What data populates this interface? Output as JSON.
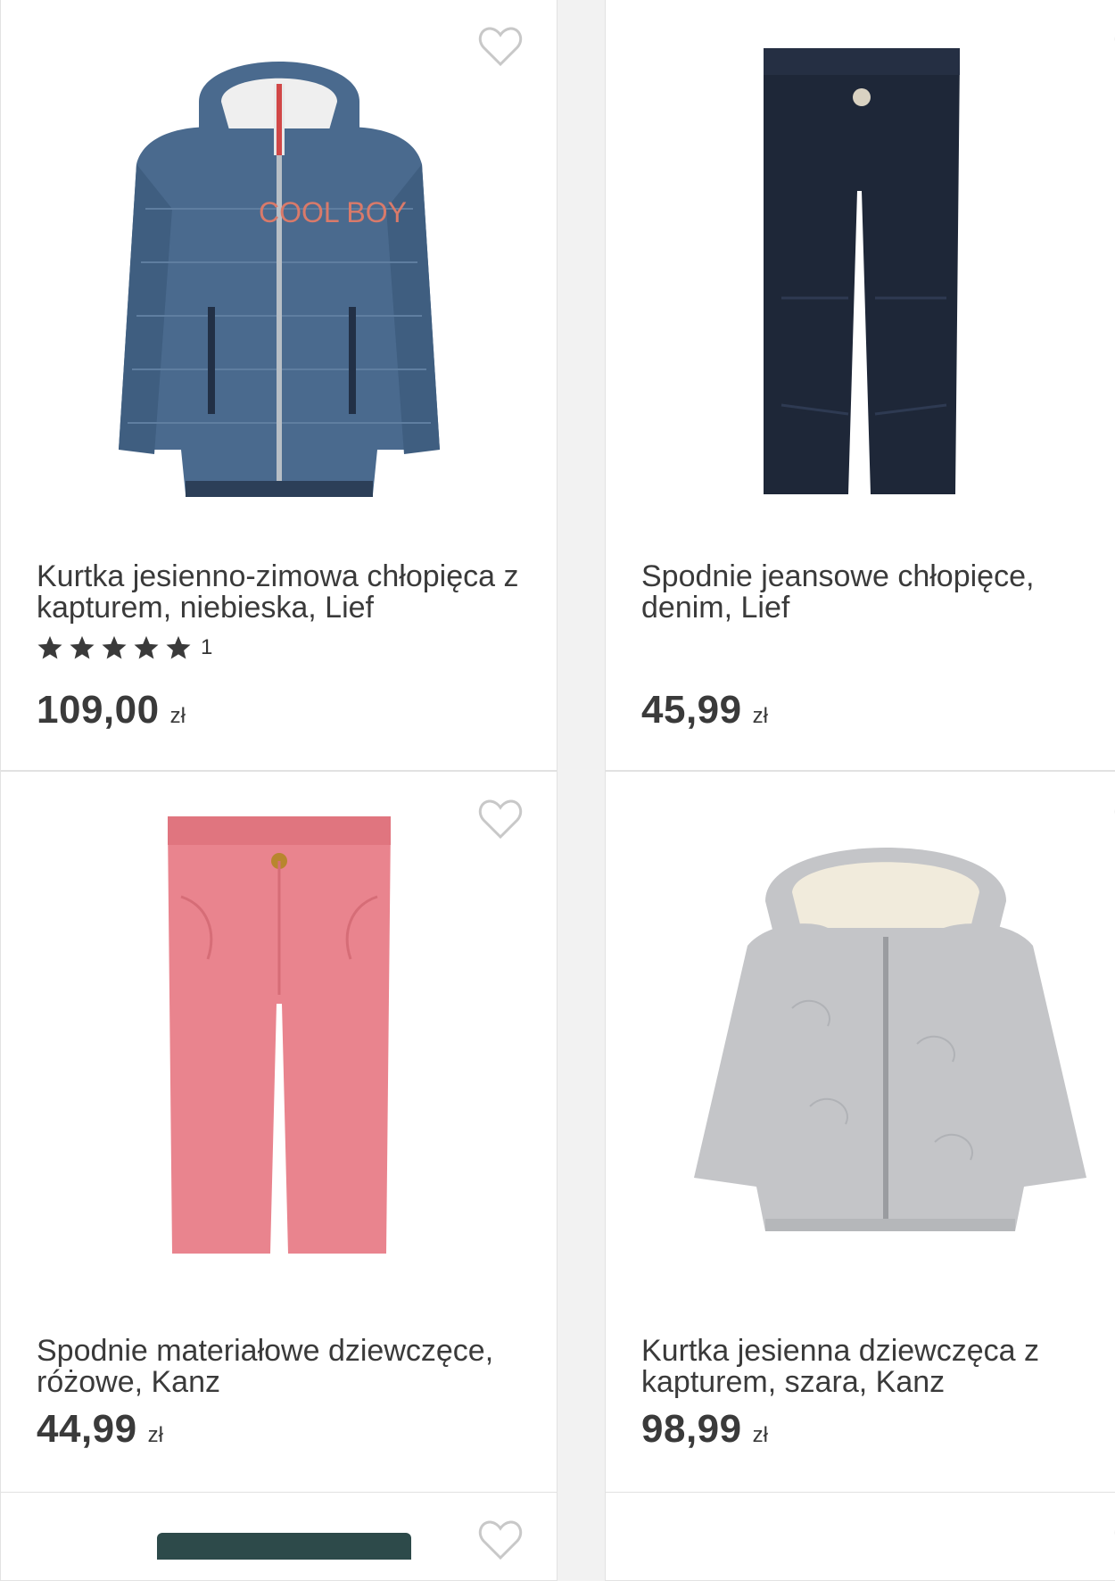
{
  "currency": "zł",
  "products": [
    {
      "title": "Kurtka jesienno-zimowa chłopięca z kapturem, niebieska, Lief",
      "rating_stars": 5,
      "rating_count": "1",
      "price": "109,00",
      "image_icon": "blue-puffer-jacket-image",
      "image_text": "COOL BOY",
      "color": "#4a6a8e"
    },
    {
      "title": "Spodnie jeansowe chłopięce, denim, Lief",
      "price": "45,99",
      "image_icon": "navy-jeans-image",
      "color": "#1e2738"
    },
    {
      "title": "Spodnie materiałowe dziewczęce, różowe, Kanz",
      "price": "44,99",
      "image_icon": "pink-trousers-image",
      "color": "#e9848e"
    },
    {
      "title": "Kurtka jesienna dziewczęca z kapturem, szara, Kanz",
      "price": "98,99",
      "image_icon": "grey-quilted-jacket-image",
      "color": "#c4c5c8"
    }
  ]
}
